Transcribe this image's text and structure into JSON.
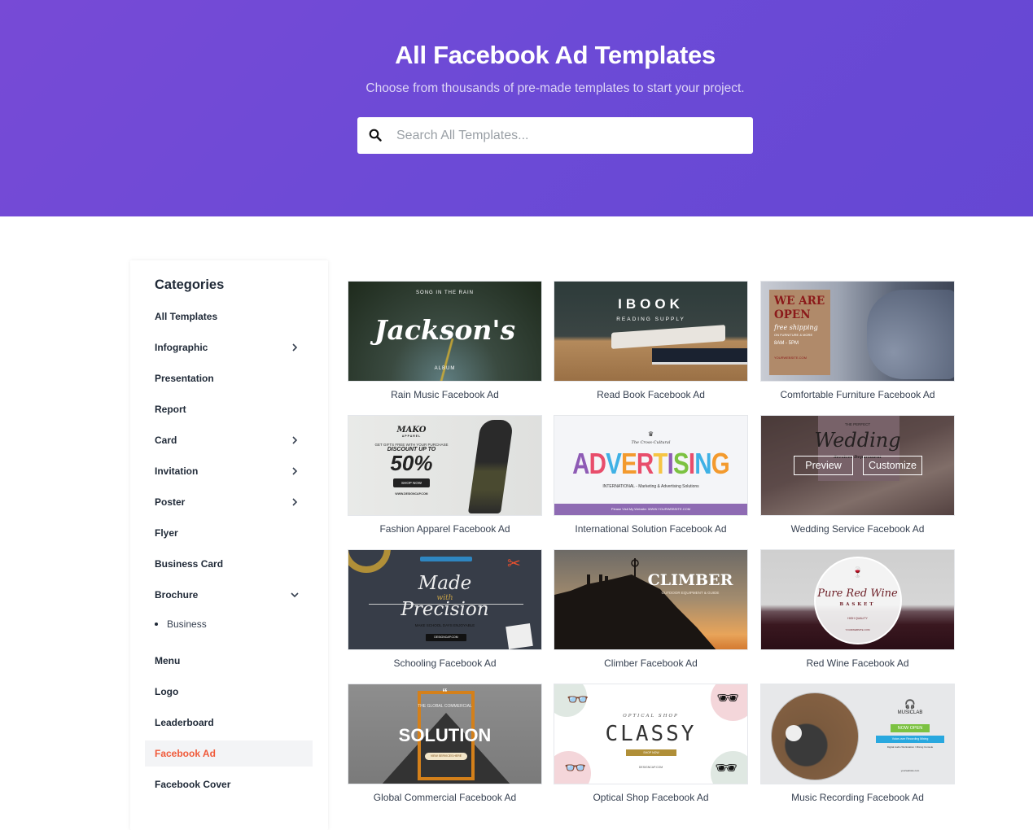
{
  "header": {
    "title": "All Facebook Ad Templates",
    "subtitle": "Choose from thousands of pre-made templates to start your project.",
    "search_placeholder": "Search All Templates...",
    "search_icon": "search-icon",
    "gradient_start": "#774ad6",
    "gradient_end": "#6547d3"
  },
  "sidebar": {
    "title": "Categories",
    "items": [
      {
        "label": "All Templates",
        "expandable": false
      },
      {
        "label": "Infographic",
        "expandable": true,
        "icon": "chevron-right-icon"
      },
      {
        "label": "Presentation",
        "expandable": false
      },
      {
        "label": "Report",
        "expandable": false
      },
      {
        "label": "Card",
        "expandable": true,
        "icon": "chevron-right-icon"
      },
      {
        "label": "Invitation",
        "expandable": true,
        "icon": "chevron-right-icon"
      },
      {
        "label": "Poster",
        "expandable": true,
        "icon": "chevron-right-icon"
      },
      {
        "label": "Flyer",
        "expandable": false
      },
      {
        "label": "Business Card",
        "expandable": false
      },
      {
        "label": "Brochure",
        "expandable": true,
        "expanded": true,
        "icon": "chevron-down-icon"
      },
      {
        "label": "Menu",
        "expandable": false
      },
      {
        "label": "Logo",
        "expandable": false
      },
      {
        "label": "Leaderboard",
        "expandable": false
      },
      {
        "label": "Facebook Ad",
        "expandable": false,
        "active": true
      },
      {
        "label": "Facebook Cover",
        "expandable": false
      }
    ],
    "brochure_sub": [
      "Business"
    ],
    "active_color": "#f05a3a"
  },
  "templates": [
    {
      "caption": "Rain Music Facebook Ad",
      "thumb": {
        "top": "SONG IN THE RAIN",
        "main": "Jackson's",
        "bottom": "ALBUM"
      }
    },
    {
      "caption": "Read Book Facebook Ad",
      "thumb": {
        "main": "IBOOK",
        "sub": "READING SUPPLY"
      }
    },
    {
      "caption": "Comfortable Furniture Facebook Ad",
      "thumb": {
        "main": "WE ARE OPEN",
        "script": "free shipping",
        "sub": "ON FURNITURE & MORE",
        "hours": "8AM - 5PM",
        "site": "YOURWEBSITE.COM"
      }
    },
    {
      "caption": "Fashion Apparel Facebook Ad",
      "thumb": {
        "brand": "MAKO",
        "brand_sub": "APPAREL",
        "line": "GET GIFTS FREE WITH YOUR PURCHASE",
        "discount": "DISCOUNT UP TO",
        "value": "50%",
        "button": "SHOP NOW",
        "site": "WWW.DESIGNCAP.COM"
      }
    },
    {
      "caption": "International Solution Facebook Ad",
      "thumb": {
        "top": "The Cross-Cultural",
        "main": "ADVERTISING",
        "sub": "INTERNATIONAL - Marketing & Advertising Solutions",
        "footer": "Please Visit My Website:  WWW.YOURWEBSITE.COM"
      }
    },
    {
      "caption": "Wedding Service Facebook Ad",
      "thumb": {
        "top": "THE PERFECT",
        "main": "Wedding",
        "sub": "Services Department"
      },
      "hovered": true,
      "actions": {
        "preview": "Preview",
        "customize": "Customize"
      }
    },
    {
      "caption": "Schooling Facebook Ad",
      "thumb": {
        "main1": "Made",
        "with": "with",
        "main2": "Precision",
        "sub": "MAKE SCHOOL DAYS ENJOYABLE",
        "button": "DESIGNCAP.COM"
      }
    },
    {
      "caption": "Climber Facebook Ad",
      "thumb": {
        "main": "CLIMBER",
        "sub": "OUTDOOR EQUIPMENT & GUIDE"
      }
    },
    {
      "caption": "Red Wine Facebook Ad",
      "thumb": {
        "main": "Pure Red Wine",
        "sub": "BASKET",
        "tag": "HIGH QUALITY",
        "site": "YOURWEBSITE.COM"
      }
    },
    {
      "caption": "Global Commercial Facebook Ad",
      "thumb": {
        "top": "THE GLOBAL COMMERCIAL",
        "main": "SOLUTION",
        "button": "VIEW SERVICES HERE"
      }
    },
    {
      "caption": "Optical Shop Facebook Ad",
      "thumb": {
        "top": "OPTICAL SHOP",
        "main": "CLASSY",
        "button": "SHOP NOW",
        "site": "DESIGNCAP.COM"
      }
    },
    {
      "caption": "Music Recording Facebook Ad",
      "thumb": {
        "brand": "MUSICLAB",
        "badge": "NOW OPEN",
        "service": "Voice-over Recording Mixing",
        "sub": "Digital Audio Workstation / Mixing Console",
        "site": "yourwebsite.com"
      }
    }
  ]
}
